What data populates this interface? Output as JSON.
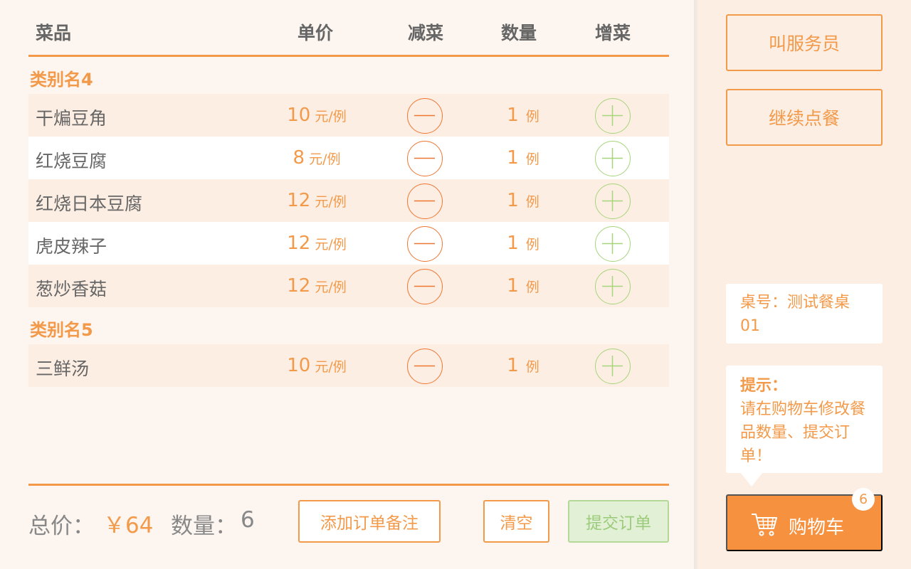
{
  "colors": {
    "accent": "#f39a4a",
    "minus": "#ee7633",
    "plus": "#a6d57c",
    "cart_bg": "#f6913f"
  },
  "header": {
    "dish": "菜品",
    "price": "单价",
    "minus": "减菜",
    "qty": "数量",
    "plus": "增菜"
  },
  "categories": [
    {
      "name": "类别名4",
      "items": [
        {
          "name": "干煸豆角",
          "price": "10",
          "price_unit": "元/例",
          "qty": "1",
          "qty_unit": "例"
        },
        {
          "name": "红烧豆腐",
          "price": "8",
          "price_unit": "元/例",
          "qty": "1",
          "qty_unit": "例"
        },
        {
          "name": "红烧日本豆腐",
          "price": "12",
          "price_unit": "元/例",
          "qty": "1",
          "qty_unit": "例"
        },
        {
          "name": "虎皮辣子",
          "price": "12",
          "price_unit": "元/例",
          "qty": "1",
          "qty_unit": "例"
        },
        {
          "name": "葱炒香菇",
          "price": "12",
          "price_unit": "元/例",
          "qty": "1",
          "qty_unit": "例"
        }
      ]
    },
    {
      "name": "类别名5",
      "items": [
        {
          "name": "三鲜汤",
          "price": "10",
          "price_unit": "元/例",
          "qty": "1",
          "qty_unit": "例"
        }
      ]
    }
  ],
  "footer": {
    "total_label": "总价：",
    "total_value": "￥64",
    "count_label": "数量：",
    "count_value": "6",
    "remark_button": "添加订单备注",
    "clear_button": "清空",
    "submit_button": "提交订单"
  },
  "sidebar": {
    "call_waiter": "叫服务员",
    "continue_ordering": "继续点餐",
    "table_label": "桌号：",
    "table_name": "测试餐桌01",
    "tip_title": "提示：",
    "tip_text": "请在购物车修改餐品数量、提交订单！",
    "cart_label": "购物车",
    "cart_count": "6"
  }
}
